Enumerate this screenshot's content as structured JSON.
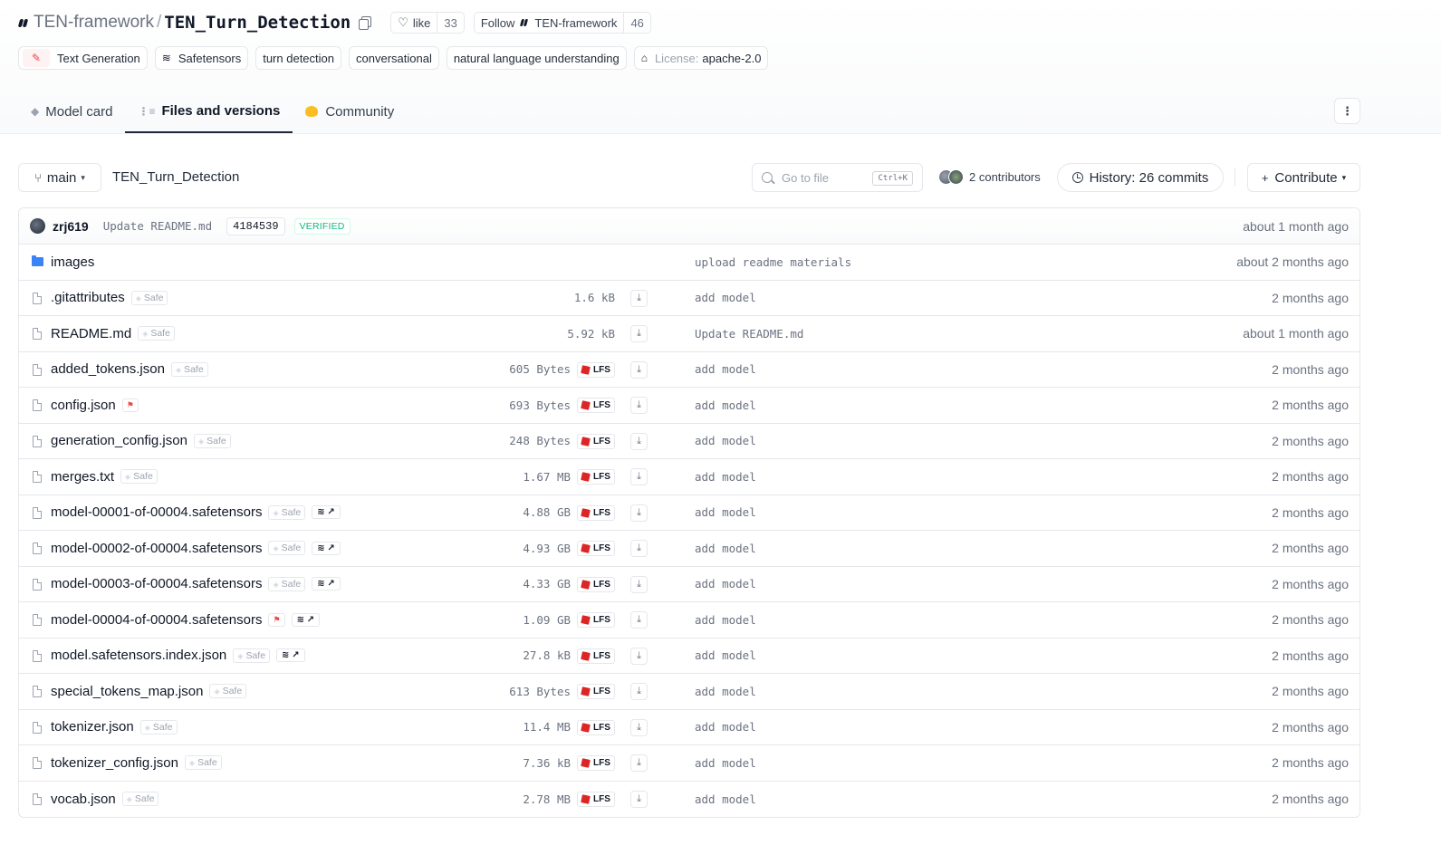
{
  "repo": {
    "org": "TEN-framework",
    "separator": "/",
    "name": "TEN_Turn_Detection",
    "like_label": "like",
    "like_count": "33",
    "follow_label": "Follow",
    "follow_org": "TEN-framework",
    "follow_count": "46"
  },
  "tags": {
    "text_generation": "Text Generation",
    "safetensors": "Safetensors",
    "turn_detection": "turn detection",
    "conversational": "conversational",
    "nlu": "natural language understanding",
    "license_label": "License:",
    "license_value": "apache-2.0"
  },
  "tabs": {
    "model_card": "Model card",
    "files": "Files and versions",
    "community": "Community"
  },
  "toolbar": {
    "branch": "main",
    "breadcrumb": "TEN_Turn_Detection",
    "search_placeholder": "Go to file",
    "shortcut": "Ctrl+K",
    "contributors": "2 contributors",
    "history": "History: 26 commits",
    "contribute": "Contribute"
  },
  "commit": {
    "user": "zrj619",
    "message": "Update README.md",
    "hash": "4184539",
    "verified": "VERIFIED",
    "time": "about 1 month ago"
  },
  "files": [
    {
      "name": "images",
      "commit": "upload readme materials",
      "time": "about 2 months ago"
    },
    {
      "name": ".gitattributes",
      "badge": "Safe",
      "size": "1.6 kB",
      "commit": "add model",
      "time": "2 months ago"
    },
    {
      "name": "README.md",
      "badge": "Safe",
      "size": "5.92 kB",
      "commit": "Update README.md",
      "time": "about 1 month ago"
    },
    {
      "name": "added_tokens.json",
      "badge": "Safe",
      "size": "605 Bytes",
      "lfs": "LFS",
      "commit": "add model",
      "time": "2 months ago"
    },
    {
      "name": "config.json",
      "size": "693 Bytes",
      "lfs": "LFS",
      "commit": "add model",
      "time": "2 months ago"
    },
    {
      "name": "generation_config.json",
      "badge": "Safe",
      "size": "248 Bytes",
      "lfs": "LFS",
      "commit": "add model",
      "time": "2 months ago"
    },
    {
      "name": "merges.txt",
      "badge": "Safe",
      "size": "1.67 MB",
      "lfs": "LFS",
      "commit": "add model",
      "time": "2 months ago"
    },
    {
      "name": "model-00001-of-00004.safetensors",
      "badge": "Safe",
      "size": "4.88 GB",
      "lfs": "LFS",
      "commit": "add model",
      "time": "2 months ago"
    },
    {
      "name": "model-00002-of-00004.safetensors",
      "badge": "Safe",
      "size": "4.93 GB",
      "lfs": "LFS",
      "commit": "add model",
      "time": "2 months ago"
    },
    {
      "name": "model-00003-of-00004.safetensors",
      "badge": "Safe",
      "size": "4.33 GB",
      "lfs": "LFS",
      "commit": "add model",
      "time": "2 months ago"
    },
    {
      "name": "model-00004-of-00004.safetensors",
      "size": "1.09 GB",
      "lfs": "LFS",
      "commit": "add model",
      "time": "2 months ago"
    },
    {
      "name": "model.safetensors.index.json",
      "badge": "Safe",
      "size": "27.8 kB",
      "lfs": "LFS",
      "commit": "add model",
      "time": "2 months ago"
    },
    {
      "name": "special_tokens_map.json",
      "badge": "Safe",
      "size": "613 Bytes",
      "lfs": "LFS",
      "commit": "add model",
      "time": "2 months ago"
    },
    {
      "name": "tokenizer.json",
      "badge": "Safe",
      "size": "11.4 MB",
      "lfs": "LFS",
      "commit": "add model",
      "time": "2 months ago"
    },
    {
      "name": "tokenizer_config.json",
      "badge": "Safe",
      "size": "7.36 kB",
      "lfs": "LFS",
      "commit": "add model",
      "time": "2 months ago"
    },
    {
      "name": "vocab.json",
      "badge": "Safe",
      "size": "2.78 MB",
      "lfs": "LFS",
      "commit": "add model",
      "time": "2 months ago"
    }
  ]
}
